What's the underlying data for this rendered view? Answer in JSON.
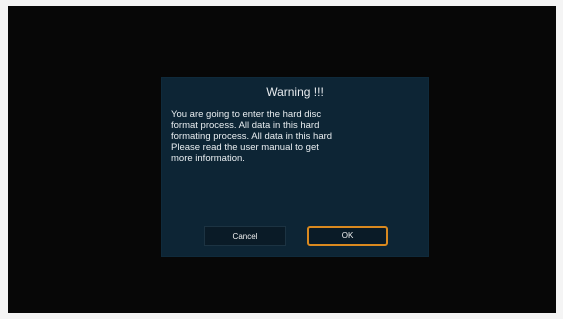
{
  "dialog": {
    "title": "Warning !!!",
    "message_lines": [
      "You are going to enter the hard disc",
      "format process. All data in this hard",
      "formating process. All data in this hard",
      "Please read the user manual to get",
      "more information."
    ],
    "cancel_label": "Cancel",
    "ok_label": "OK",
    "focused_button": "OK"
  },
  "colors": {
    "screen_background": "#070707",
    "dialog_background": "#0d2535",
    "focus_accent": "#d9891f"
  }
}
